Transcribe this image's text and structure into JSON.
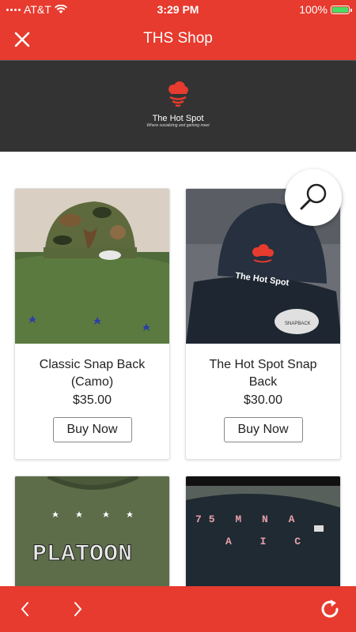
{
  "status_bar": {
    "carrier": "AT&T",
    "time": "3:29 PM",
    "battery": "100%"
  },
  "header": {
    "title": "THS Shop",
    "close_icon": "close-icon"
  },
  "banner": {
    "logo_name": "The Hot Spot",
    "logo_tagline": "Where socializing and gaming meet"
  },
  "search": {
    "icon": "search-icon"
  },
  "products": [
    {
      "name": "Classic Snap Back (Camo)",
      "price": "$35.00",
      "button": "Buy Now"
    },
    {
      "name": "The Hot Spot Snap Back",
      "price": "$30.00",
      "button": "Buy Now",
      "cap_print": "The Hot Spot",
      "cap_sticker": "SNAPBACK"
    },
    {
      "shirt_print": "PLATOON"
    },
    {
      "shirt_print_line1": "75 M N A",
      "shirt_print_line2": "A I C"
    }
  ],
  "colors": {
    "brand_red": "#e63b2e",
    "banner_dark": "#333333"
  },
  "bottom_nav": {
    "back_icon": "chevron-left-icon",
    "forward_icon": "chevron-right-icon",
    "refresh_icon": "refresh-icon"
  }
}
